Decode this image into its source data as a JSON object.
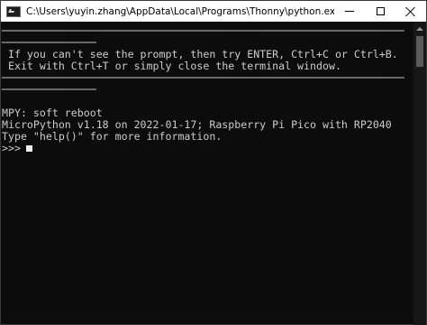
{
  "window": {
    "title": "C:\\Users\\yuyin.zhang\\AppData\\Local\\Programs\\Thonny\\python.exe",
    "colors": {
      "background": "#0c0c0c",
      "text": "#cccccc",
      "titlebar": "#ffffff"
    }
  },
  "terminal": {
    "lines": [
      "────────────────────────────────────────────────────────────────",
      "───────────────",
      " If you can't see the prompt, then try ENTER, Ctrl+C or Ctrl+B.",
      " Exit with Ctrl+T or simply close the terminal window.",
      "────────────────────────────────────────────────────────────────",
      "───────────────",
      "",
      "MPY: soft reboot",
      "MicroPython v1.18 on 2022-01-17; Raspberry Pi Pico with RP2040",
      "Type \"help()\" for more information.",
      ">>>"
    ]
  }
}
